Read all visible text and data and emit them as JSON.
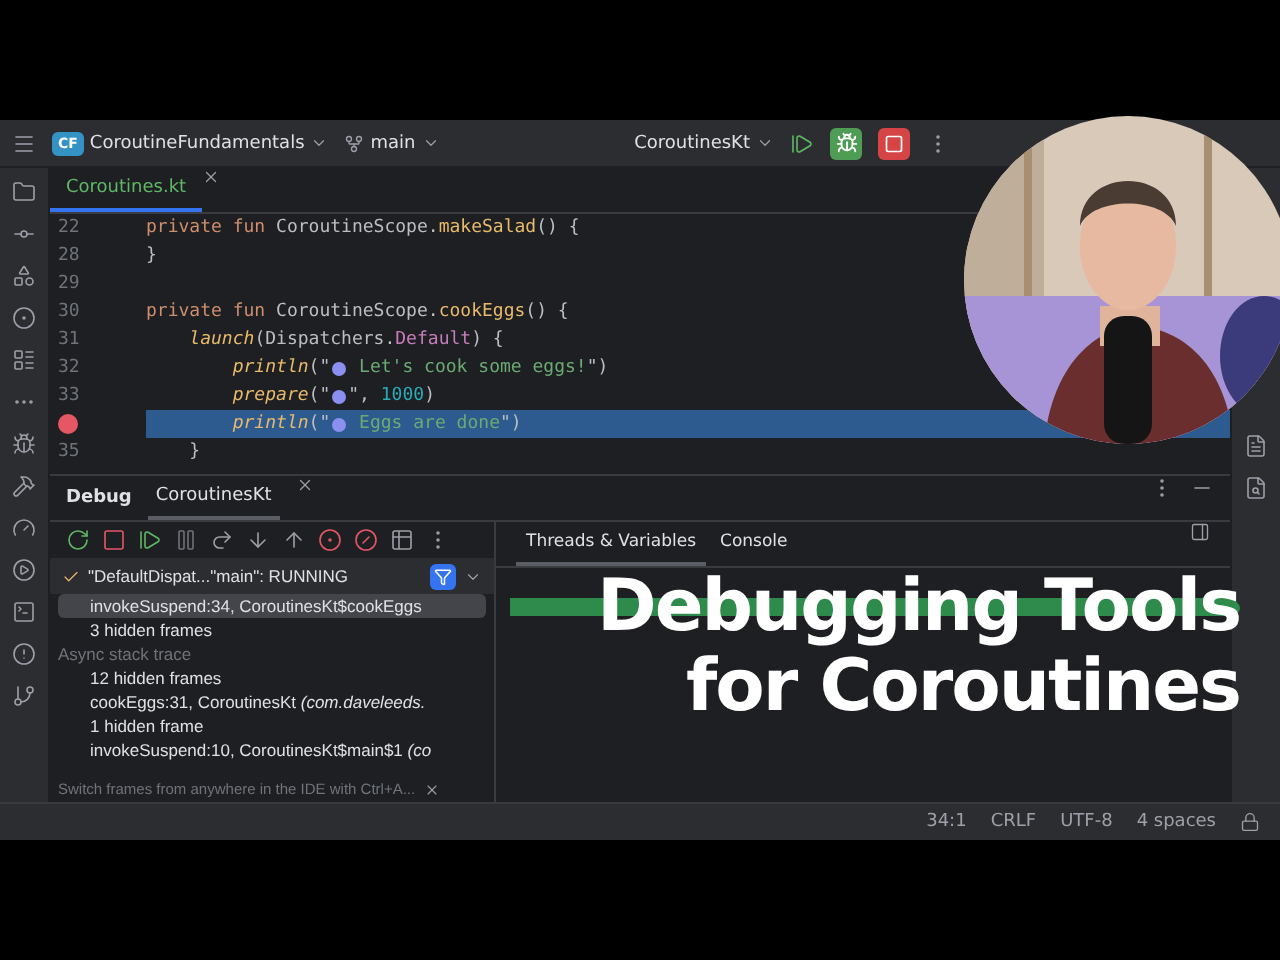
{
  "title_bar": {
    "project_badge": "CF",
    "project": "CoroutineFundamentals",
    "branch": "main",
    "run_config": "CoroutinesKt"
  },
  "editor_tabs": [
    {
      "label": "Coroutines.kt",
      "selected": true
    }
  ],
  "code_lines": [
    {
      "number": "22",
      "breakpoint": false,
      "current": false,
      "tokens": [
        {
          "kind": "keyword",
          "text": "private fun "
        },
        {
          "kind": "plain",
          "text": "CoroutineScope."
        },
        {
          "kind": "fn",
          "text": "makeSalad"
        },
        {
          "kind": "plain",
          "text": "() {"
        }
      ]
    },
    {
      "number": "28",
      "breakpoint": false,
      "current": false,
      "tokens": [
        {
          "kind": "plain",
          "text": "}"
        }
      ]
    },
    {
      "number": "29",
      "breakpoint": false,
      "current": false
    },
    {
      "number": "30",
      "breakpoint": false,
      "current": false,
      "tokens": [
        {
          "kind": "keyword",
          "text": "private fun "
        },
        {
          "kind": "plain",
          "text": "CoroutineScope."
        },
        {
          "kind": "fn",
          "text": "cookEggs"
        },
        {
          "kind": "plain",
          "text": "() {"
        }
      ]
    },
    {
      "number": "31",
      "breakpoint": false,
      "current": false,
      "tokens": [
        {
          "kind": "call",
          "text": "    launch"
        },
        {
          "kind": "plain",
          "text": "(Dispatchers."
        },
        {
          "kind": "field",
          "text": "Default"
        },
        {
          "kind": "plain",
          "text": ") {"
        }
      ]
    },
    {
      "number": "32",
      "breakpoint": false,
      "current": false,
      "tokens": [
        {
          "kind": "call",
          "text": "        println"
        },
        {
          "kind": "plain",
          "text": "(\""
        },
        {
          "kind": "emoji"
        },
        {
          "kind": "string",
          "text": " Let's cook some eggs!"
        },
        {
          "kind": "plain",
          "text": "\")"
        }
      ]
    },
    {
      "number": "33",
      "breakpoint": false,
      "current": false,
      "tokens": [
        {
          "kind": "call",
          "text": "        prepare"
        },
        {
          "kind": "plain",
          "text": "(\""
        },
        {
          "kind": "emoji"
        },
        {
          "kind": "plain",
          "text": "\", "
        },
        {
          "kind": "number",
          "text": "1000"
        },
        {
          "kind": "plain",
          "text": ")"
        }
      ]
    },
    {
      "breakpoint": true,
      "current": true,
      "tokens": [
        {
          "kind": "call",
          "text": "        println"
        },
        {
          "kind": "plain",
          "text": "(\""
        },
        {
          "kind": "emoji"
        },
        {
          "kind": "string",
          "text": " Eggs are done"
        },
        {
          "kind": "plain",
          "text": "\")"
        }
      ]
    },
    {
      "number": "35",
      "breakpoint": false,
      "current": false,
      "tokens": [
        {
          "kind": "plain",
          "text": "    }"
        }
      ]
    }
  ],
  "debug": {
    "title": "Debug",
    "tabs": [
      {
        "label": "CoroutinesKt",
        "selected": true
      }
    ],
    "thread": "\"DefaultDispat...\"main\": RUNNING",
    "frames": [
      {
        "kind": "frame",
        "text": "invokeSuspend:34, CoroutinesKt$cookEggs",
        "selected": true
      },
      {
        "kind": "frame",
        "text": "3 hidden frames",
        "selected": false
      },
      {
        "kind": "section",
        "text": "Async stack trace",
        "selected": false
      },
      {
        "kind": "frame",
        "text": "12 hidden frames",
        "selected": false
      },
      {
        "kind": "frame",
        "text": "cookEggs:31, CoroutinesKt *(com.daveleeds.*",
        "selected": false
      },
      {
        "kind": "frame",
        "text": "1 hidden frame",
        "selected": false
      },
      {
        "kind": "frame",
        "text": "invokeSuspend:10, CoroutinesKt$main$1 *(co*",
        "selected": false
      }
    ],
    "hint": "Switch frames from anywhere in the IDE with Ctrl+A...",
    "view_tabs": [
      {
        "label": "Threads & Variables",
        "selected": true
      },
      {
        "label": "Console",
        "selected": false
      }
    ]
  },
  "thumbnail_title": [
    "Debugging Tools",
    "for Coroutines"
  ],
  "webcam": {
    "kind": "picture"
  },
  "status_bar": [
    "34:1",
    "CRLF",
    "UTF-8",
    "4 spaces"
  ]
}
